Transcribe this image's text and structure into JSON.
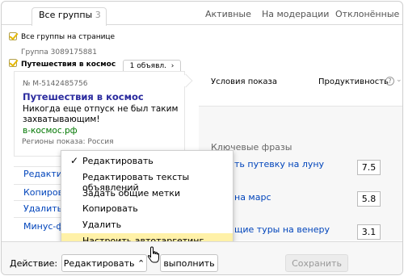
{
  "tabs": {
    "all_label": "Все группы",
    "all_count": "3",
    "active": "Активные",
    "moderation": "На модерации",
    "rejected": "Отклонённые"
  },
  "left": {
    "all_on_page": "Все группы на странице",
    "group_id": "Группа 3089175881",
    "group_name": "Путешествия в космос",
    "ad_count_button": "1 объявл.",
    "ad_number": "№ М-5142485756",
    "ad_title": "Путешествия в космос",
    "ad_text_line1": "Никогда еще отпуск не был таким",
    "ad_text_line2": "захватывающим!",
    "ad_domain": "в-космос.рф",
    "regions": "Регионы показа: Россия",
    "links": [
      "Редактир",
      "Копиров",
      "Удалить г",
      "Минус-ф"
    ]
  },
  "right": {
    "conditions": "Условия показа",
    "productivity": "Продуктивность",
    "keywords_header": "Ключевые фразы",
    "phrases": [
      {
        "text": "ть путевку на луну",
        "value": "7.5"
      },
      {
        "text": "на марс",
        "value": "5.8"
      },
      {
        "text": "щие туры на венеру",
        "value": "3.1"
      }
    ]
  },
  "menu": {
    "items": [
      "Редактировать",
      "Редактировать тексты объявлений",
      "Задать общие метки",
      "Копировать",
      "Удалить",
      "Настроить автотаргетинг"
    ],
    "checked_index": 0,
    "highlighted_index": 5
  },
  "footer": {
    "action_label": "Действие:",
    "select_value": "Редактировать",
    "run_button": "выполнить",
    "save_button": "Сохранить"
  },
  "colors": {
    "link": "#0044bb",
    "highlight": "#fff1a8",
    "checkbox_yellow": "#e5b800"
  }
}
